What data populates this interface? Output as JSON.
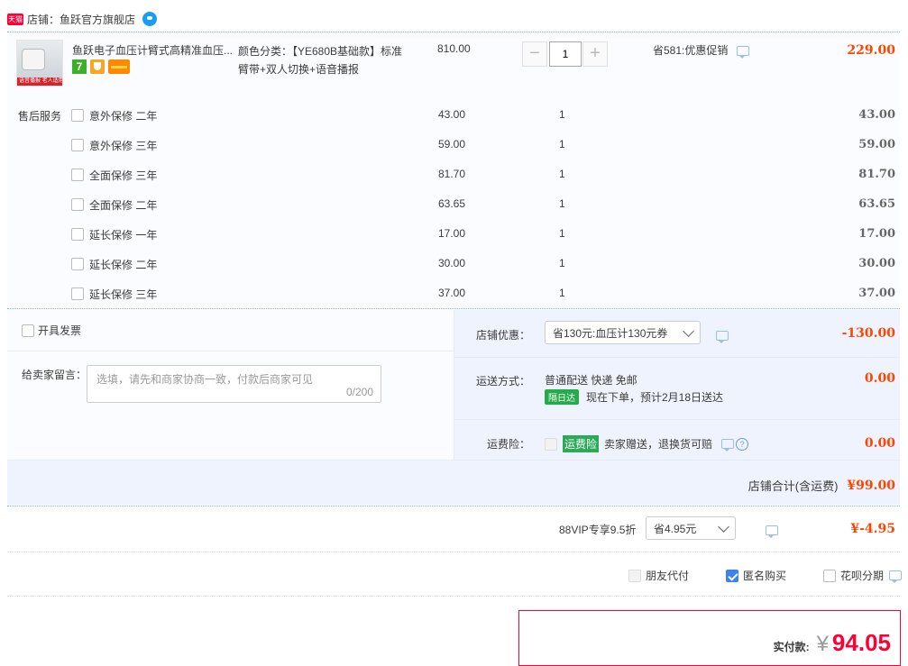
{
  "store": {
    "badge": "天猫",
    "label": "店铺：鱼跃官方旗舰店"
  },
  "product": {
    "title": "鱼跃电子血压计臂式高精准血压...",
    "image_caption": "语音播报 老人适用",
    "badge_seven": "7",
    "sku": "颜色分类：【YE680B基础款】标准臂带+双人切换+语音播报",
    "unit_price": "810.00",
    "quantity": "1",
    "minus_label": "−",
    "plus_label": "+",
    "promo": "省581:优惠促销",
    "subtotal": "229.00"
  },
  "services": {
    "label": "售后服务",
    "items": [
      {
        "name": "意外保修 二年",
        "price": "43.00",
        "qty": "1",
        "total": "43.00"
      },
      {
        "name": "意外保修 三年",
        "price": "59.00",
        "qty": "1",
        "total": "59.00"
      },
      {
        "name": "全面保修 三年",
        "price": "81.70",
        "qty": "1",
        "total": "81.70"
      },
      {
        "name": "全面保修 二年",
        "price": "63.65",
        "qty": "1",
        "total": "63.65"
      },
      {
        "name": "延长保修 一年",
        "price": "17.00",
        "qty": "1",
        "total": "17.00"
      },
      {
        "name": "延长保修 二年",
        "price": "30.00",
        "qty": "1",
        "total": "30.00"
      },
      {
        "name": "延长保修 三年",
        "price": "37.00",
        "qty": "1",
        "total": "37.00"
      }
    ]
  },
  "invoice": {
    "label": "开具发票"
  },
  "remark": {
    "label": "给卖家留言：",
    "placeholder": "选填，请先和商家协商一致，付款后商家可见",
    "counter": "0/200"
  },
  "store_discount": {
    "label": "店铺优惠：",
    "selected": "省130元:血压计130元券",
    "amount": "-130.00"
  },
  "shipping": {
    "label": "运送方式：",
    "method": "普通配送 快递 免邮",
    "tag": "隔日达",
    "eta": "现在下单，预计2月18日送达",
    "amount": "0.00"
  },
  "insurance": {
    "label": "运费险：",
    "tag": "运费险",
    "desc": "卖家赠送，退换货可赔",
    "help": "?",
    "amount": "0.00"
  },
  "store_total": {
    "label": "店铺合计(含运费)",
    "amount": "¥99.00"
  },
  "vip": {
    "label": "88VIP专享9.5折",
    "selected": "省4.95元",
    "amount": "¥-4.95"
  },
  "options": {
    "friend_pay": "朋友代付",
    "anonymous": "匿名购买",
    "huabei": "花呗分期"
  },
  "payment": {
    "label": "实付款:",
    "currency": "¥",
    "amount": "94.05"
  },
  "colors": {
    "accent_red": "#ff0036",
    "price_red": "#ff4400",
    "tmall_red": "#ff0036",
    "link_blue": "#3b83f0",
    "panel_bg": "#eff3fd"
  }
}
